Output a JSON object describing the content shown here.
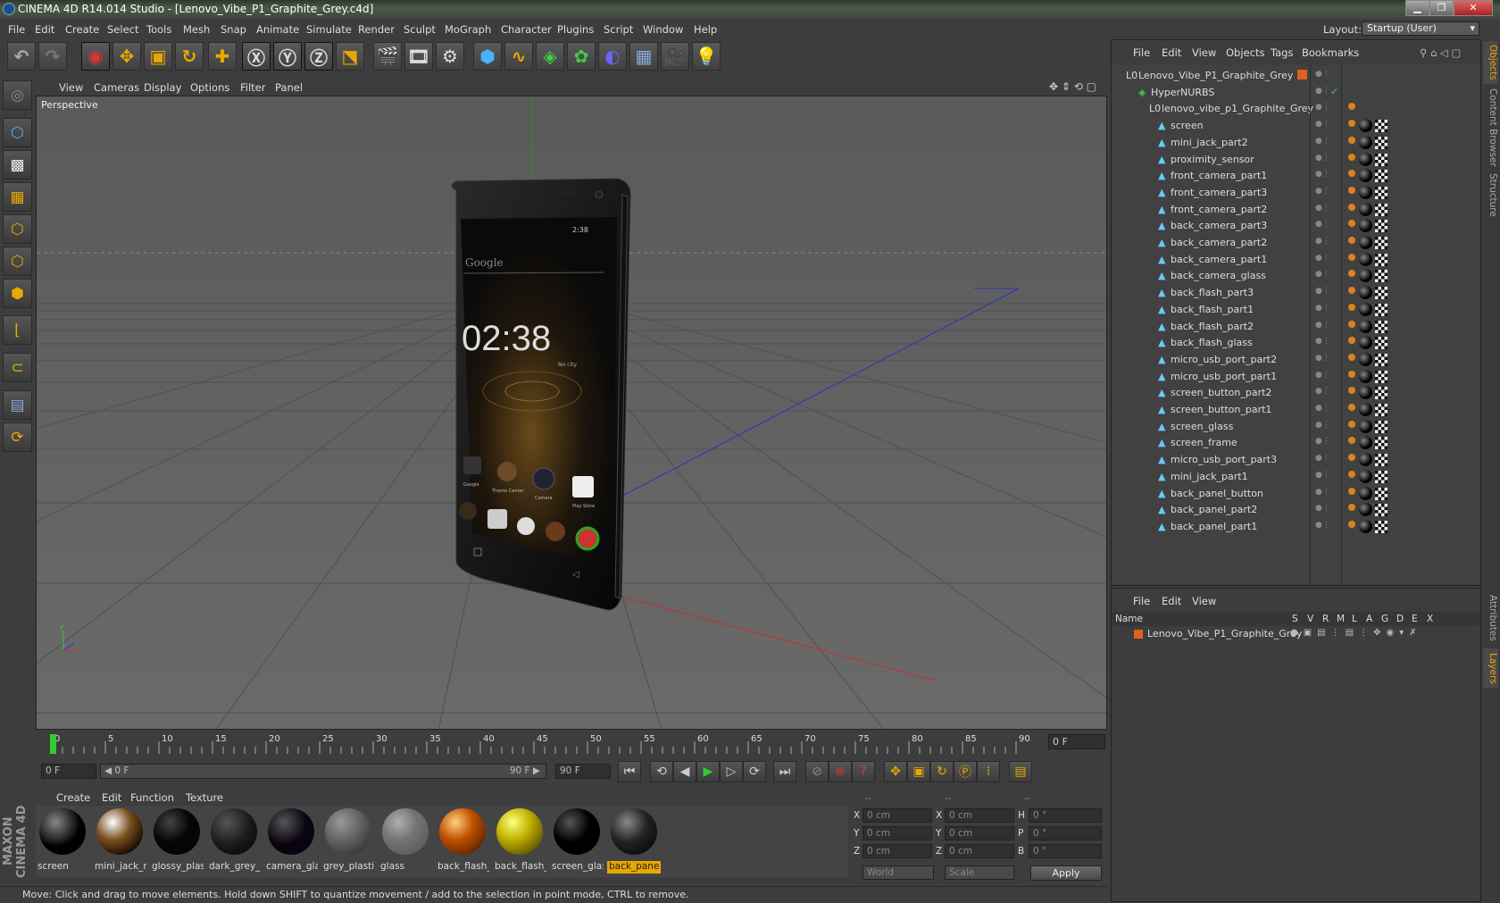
{
  "window": {
    "title": "CINEMA 4D R14.014 Studio - [Lenovo_Vibe_P1_Graphite_Grey.c4d]",
    "minimize": "▁",
    "restore": "❐",
    "close": "✕"
  },
  "menubar": {
    "items": [
      "File",
      "Edit",
      "Create",
      "Select",
      "Tools",
      "Mesh",
      "Snap",
      "Animate",
      "Simulate",
      "Render",
      "Sculpt",
      "MoGraph",
      "Character",
      "Plugins",
      "Script",
      "Window",
      "Help"
    ],
    "layout_label": "Layout:",
    "layout_value": "Startup (User)"
  },
  "toolbar": {
    "icons": [
      "undo-icon",
      "redo-icon",
      "live-selection-icon",
      "move-icon",
      "scale-icon",
      "rotate-icon",
      "add-icon",
      "x-axis-icon",
      "y-axis-icon",
      "z-axis-icon",
      "coordinate-system-icon",
      "render-view-icon",
      "render-picture-viewer-icon",
      "edit-render-settings-icon",
      "cube-icon",
      "spline-pen-icon",
      "nurbs-icon",
      "array-icon",
      "deformer-icon",
      "floor-icon",
      "camera-icon",
      "light-icon"
    ]
  },
  "viewport": {
    "menu": [
      "View",
      "Cameras",
      "Display",
      "Options",
      "Filter",
      "Panel"
    ],
    "label": "Perspective"
  },
  "phone_screen": {
    "status_time": "2:38",
    "search_text": "Google",
    "clock": "02:38",
    "weather": "No city",
    "apps": [
      "Google",
      "Theme Center",
      "Camera",
      "Play Store"
    ]
  },
  "timeline": {
    "ticks": [
      "0",
      "5",
      "10",
      "15",
      "20",
      "25",
      "30",
      "35",
      "40",
      "45",
      "50",
      "55",
      "60",
      "65",
      "70",
      "75",
      "80",
      "85",
      "90"
    ],
    "current_frame": "0 F"
  },
  "transport": {
    "start_field": "0 F",
    "range_start": "◀ 0 F",
    "range_end": "90 F ▶",
    "end_field": "90 F"
  },
  "material_manager": {
    "menu": [
      "Create",
      "Edit",
      "Function",
      "Texture"
    ],
    "materials": [
      {
        "name": "screen",
        "color": "#000000"
      },
      {
        "name": "mini_jack_r",
        "color": "#7a5020"
      },
      {
        "name": "glossy_plas",
        "color": "#050505"
      },
      {
        "name": "dark_grey_",
        "color": "#1c1c1c"
      },
      {
        "name": "camera_gla",
        "color": "#0a0410"
      },
      {
        "name": "grey_plasti",
        "color": "#606060"
      },
      {
        "name": "glass",
        "color": "#8a8a8a"
      },
      {
        "name": "back_flash_",
        "color": "#c05000"
      },
      {
        "name": "back_flash_",
        "color": "#c0b000"
      },
      {
        "name": "screen_gla:",
        "color": "#000000"
      },
      {
        "name": "back_pane",
        "color": "#222222"
      }
    ],
    "logo_text": "MAXON CINEMA 4D"
  },
  "coordinates": {
    "header": [
      "--",
      "--",
      "--"
    ],
    "rows": [
      {
        "a": "X",
        "av": "0 cm",
        "b": "X",
        "bv": "0 cm",
        "c": "H",
        "cv": "0 °"
      },
      {
        "a": "Y",
        "av": "0 cm",
        "b": "Y",
        "bv": "0 cm",
        "c": "P",
        "cv": "0 °"
      },
      {
        "a": "Z",
        "av": "0 cm",
        "b": "Z",
        "bv": "0 cm",
        "c": "B",
        "cv": "0 °"
      }
    ],
    "space": "World",
    "mode": "Scale",
    "apply": "Apply"
  },
  "status": "Move: Click and drag to move elements. Hold down SHIFT to quantize movement / add to the selection in point mode, CTRL to remove.",
  "object_manager": {
    "menu": [
      "File",
      "Edit",
      "View",
      "Objects",
      "Tags",
      "Bookmarks"
    ],
    "root": "Lenovo_Vibe_P1_Graphite_Grey",
    "hypernurbs": "HyperNURBS",
    "group": "lenovo_vibe_p1_Graphite_Grey",
    "objects": [
      "screen",
      "mini_jack_part2",
      "proximity_sensor",
      "front_camera_part1",
      "front_camera_part3",
      "front_camera_part2",
      "back_camera_part3",
      "back_camera_part2",
      "back_camera_part1",
      "back_camera_glass",
      "back_flash_part3",
      "back_flash_part1",
      "back_flash_part2",
      "back_flash_glass",
      "micro_usb_port_part2",
      "micro_usb_port_part1",
      "screen_button_part2",
      "screen_button_part1",
      "screen_glass",
      "screen_frame",
      "micro_usb_port_part3",
      "mini_jack_part1",
      "back_panel_button",
      "back_panel_part2",
      "back_panel_part1"
    ]
  },
  "layer_manager": {
    "menu": [
      "File",
      "Edit",
      "View"
    ],
    "columns": [
      "Name",
      "S",
      "V",
      "R",
      "M",
      "L",
      "A",
      "G",
      "D",
      "E",
      "X"
    ],
    "layer": "Lenovo_Vibe_P1_Graphite_Grey"
  },
  "right_tabs": [
    "Objects",
    "Content Browser",
    "Structure",
    "Attributes",
    "Layers"
  ]
}
